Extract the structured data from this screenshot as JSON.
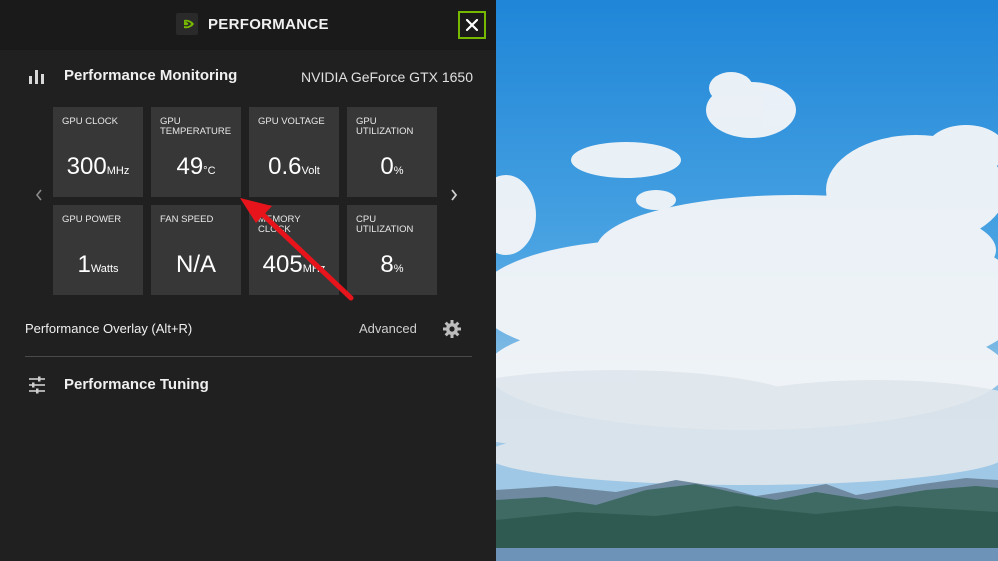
{
  "window": {
    "title": "PERFORMANCE"
  },
  "monitoring": {
    "title": "Performance Monitoring",
    "gpu_name": "NVIDIA GeForce GTX 1650"
  },
  "tiles": [
    {
      "label": "GPU CLOCK",
      "value": "300",
      "unit": "MHz"
    },
    {
      "label": "GPU TEMPERATURE",
      "value": "49",
      "unit": "°C"
    },
    {
      "label": "GPU VOLTAGE",
      "value": "0.6",
      "unit": "Volt"
    },
    {
      "label": "GPU UTILIZATION",
      "value": "0",
      "unit": "%"
    },
    {
      "label": "GPU POWER",
      "value": "1",
      "unit": "Watts"
    },
    {
      "label": "FAN SPEED",
      "value": "N/A",
      "unit": ""
    },
    {
      "label": "MEMORY CLOCK",
      "value": "405",
      "unit": "MHz"
    },
    {
      "label": "CPU UTILIZATION",
      "value": "8",
      "unit": "%"
    }
  ],
  "overlay": {
    "label": "Performance Overlay (Alt+R)",
    "advanced_label": "Advanced"
  },
  "tuning": {
    "label": "Performance Tuning"
  },
  "colors": {
    "accent": "#76b900",
    "annotation_arrow": "#e8141c"
  },
  "icons": [
    "nvidia-logo-icon",
    "close-icon",
    "bar-chart-icon",
    "chevron-left-icon",
    "chevron-right-icon",
    "gear-icon",
    "sliders-icon"
  ]
}
